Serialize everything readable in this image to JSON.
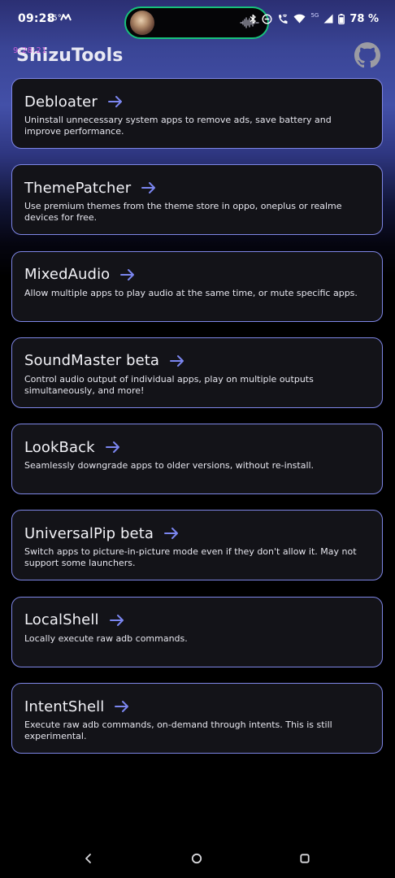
{
  "status_bar": {
    "time": "09:28",
    "temperature": "15°",
    "battery": "78 %",
    "network_label": "5G"
  },
  "header": {
    "overlay_clock": "9:28:21",
    "title": "ShizuTools",
    "github_icon": "github-icon"
  },
  "colors": {
    "card_border": "#7e86e6",
    "accent_arrow": "#7b86f0",
    "card_background": "#131318",
    "island_border": "#17c17b"
  },
  "tools": [
    {
      "title": "Debloater",
      "description": "Uninstall unnecessary system apps to remove ads, save battery and improve performance."
    },
    {
      "title": "ThemePatcher",
      "description": "Use premium themes from the theme store in oppo, oneplus or realme devices for free."
    },
    {
      "title": "MixedAudio",
      "description": "Allow multiple apps to play audio at the same time, or mute specific apps."
    },
    {
      "title": "SoundMaster beta",
      "description": "Control audio output of individual apps, play on multiple outputs simultaneously, and more!"
    },
    {
      "title": "LookBack",
      "description": "Seamlessly downgrade apps to older versions, without re-install."
    },
    {
      "title": "UniversalPip beta",
      "description": "Switch apps to picture-in-picture mode even if they don't allow it. May not support some launchers."
    },
    {
      "title": "LocalShell",
      "description": "Locally execute raw adb commands."
    },
    {
      "title": "IntentShell",
      "description": "Execute raw adb commands, on-demand through intents. This is still experimental."
    }
  ],
  "nav_bar": {
    "back_icon": "back-icon",
    "home_icon": "home-icon",
    "recents_icon": "recents-icon"
  }
}
